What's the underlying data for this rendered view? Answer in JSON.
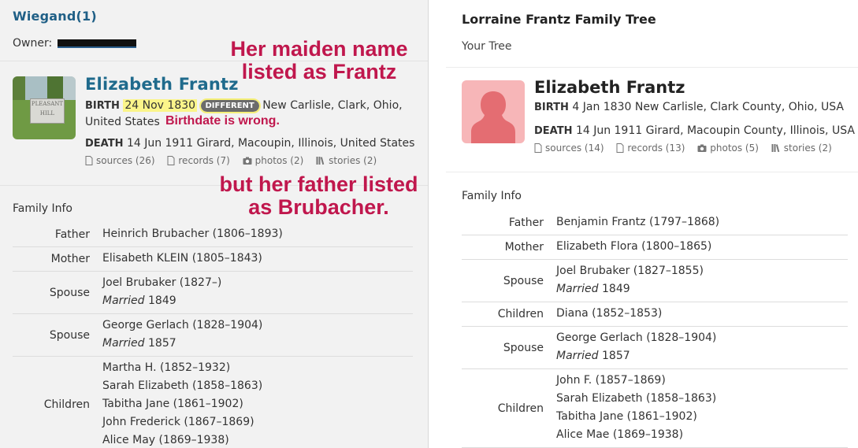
{
  "left": {
    "tree_title": "Wiegand(1)",
    "owner_label": "Owner:",
    "person": {
      "name": "Elizabeth Frantz",
      "photo_sign_text": "PLEASANT HILL",
      "birth_label": "BIRTH",
      "birth_date": "24 Nov 1830",
      "different_badge": "DIFFERENT",
      "birth_place": "New Carlisle, Clark, Ohio, United States",
      "death_label": "DEATH",
      "death_text": "14 Jun 1911 Girard, Macoupin, Illinois, United States",
      "links": {
        "sources": "sources (26)",
        "records": "records (7)",
        "photos": "photos (2)",
        "stories": "stories (2)"
      }
    },
    "family_title": "Family Info",
    "family": [
      {
        "relation": "Father",
        "members": [
          {
            "name": "Heinrich Brubacher",
            "years": "(1806–1893)"
          }
        ]
      },
      {
        "relation": "Mother",
        "members": [
          {
            "name": "Elisabeth KLEIN",
            "years": "(1805–1843)"
          }
        ]
      },
      {
        "relation": "Spouse",
        "members": [
          {
            "name": "Joel Brubaker",
            "years": "(1827–)"
          }
        ],
        "married_label": "Married",
        "married_year": "1849"
      },
      {
        "relation": "Spouse",
        "members": [
          {
            "name": "George Gerlach",
            "years": "(1828–1904)"
          }
        ],
        "married_label": "Married",
        "married_year": "1857"
      },
      {
        "relation": "Children",
        "members": [
          {
            "name": "Martha H.",
            "years": "(1852–1932)"
          },
          {
            "name": "Sarah Elizabeth",
            "years": "(1858–1863)"
          },
          {
            "name": "Tabitha Jane",
            "years": "(1861–1902)"
          },
          {
            "name": "John Frederick",
            "years": "(1867–1869)"
          },
          {
            "name": "Alice May",
            "years": "(1869–1938)"
          }
        ]
      }
    ]
  },
  "annotations": {
    "maiden": "Her maiden name listed as Frantz",
    "birthdate": "Birthdate is wrong.",
    "father": "but her father listed as Brubacher."
  },
  "right": {
    "tree_title": "Lorraine Frantz Family Tree",
    "subtitle": "Your Tree",
    "person": {
      "name": "Elizabeth Frantz",
      "birth_label": "BIRTH",
      "birth_text": "4 Jan 1830 New Carlisle, Clark County, Ohio, USA",
      "death_label": "DEATH",
      "death_text": "14 Jun 1911 Girard, Macoupin County, Illinois, USA",
      "links": {
        "sources": "sources (14)",
        "records": "records (13)",
        "photos": "photos (5)",
        "stories": "stories (2)"
      }
    },
    "family_title": "Family Info",
    "family": [
      {
        "relation": "Father",
        "members": [
          {
            "name": "Benjamin Frantz",
            "years": "(1797–1868)"
          }
        ]
      },
      {
        "relation": "Mother",
        "members": [
          {
            "name": "Elizabeth Flora",
            "years": "(1800–1865)"
          }
        ]
      },
      {
        "relation": "Spouse",
        "members": [
          {
            "name": "Joel Brubaker",
            "years": "(1827–1855)"
          }
        ],
        "married_label": "Married",
        "married_year": "1849"
      },
      {
        "relation": "Children",
        "members": [
          {
            "name": "Diana",
            "years": "(1852–1853)"
          }
        ]
      },
      {
        "relation": "Spouse",
        "members": [
          {
            "name": "George Gerlach",
            "years": "(1828–1904)"
          }
        ],
        "married_label": "Married",
        "married_year": "1857"
      },
      {
        "relation": "Children",
        "members": [
          {
            "name": "John F.",
            "years": "(1857–1869)"
          },
          {
            "name": "Sarah Elizabeth",
            "years": "(1858–1863)"
          },
          {
            "name": "Tabitha Jane",
            "years": "(1861–1902)"
          },
          {
            "name": "Alice Mae",
            "years": "(1869–1938)"
          }
        ]
      }
    ]
  },
  "colors": {
    "link_blue": "#1f6a8c",
    "annotation_red": "#c0174d",
    "highlight_yellow": "#fbf58a",
    "silhouette_bg": "#f7b6b8",
    "silhouette_fg": "#e46d72"
  },
  "icons": {
    "sources": "document-icon",
    "records": "document-icon",
    "photos": "camera-icon",
    "stories": "stories-icon"
  }
}
